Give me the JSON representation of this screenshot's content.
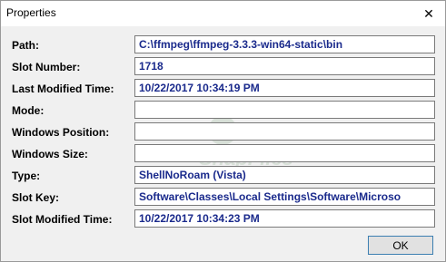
{
  "window": {
    "title": "Properties",
    "close_glyph": "✕"
  },
  "fields": [
    {
      "label": "Path:",
      "value": "C:\\ffmpeg\\ffmpeg-3.3.3-win64-static\\bin"
    },
    {
      "label": "Slot Number:",
      "value": "1718"
    },
    {
      "label": "Last Modified Time:",
      "value": "10/22/2017 10:34:19 PM"
    },
    {
      "label": "Mode:",
      "value": ""
    },
    {
      "label": "Windows Position:",
      "value": ""
    },
    {
      "label": "Windows Size:",
      "value": ""
    },
    {
      "label": "Type:",
      "value": "ShellNoRoam (Vista)"
    },
    {
      "label": "Slot Key:",
      "value": "Software\\Classes\\Local Settings\\Software\\Microso"
    },
    {
      "label": "Slot Modified Time:",
      "value": "10/22/2017 10:34:23 PM"
    }
  ],
  "buttons": {
    "ok": "OK"
  },
  "watermark": {
    "text": "SnapFiles"
  },
  "colors": {
    "value_text": "#1a2a8c",
    "background": "#f0f0f0"
  }
}
